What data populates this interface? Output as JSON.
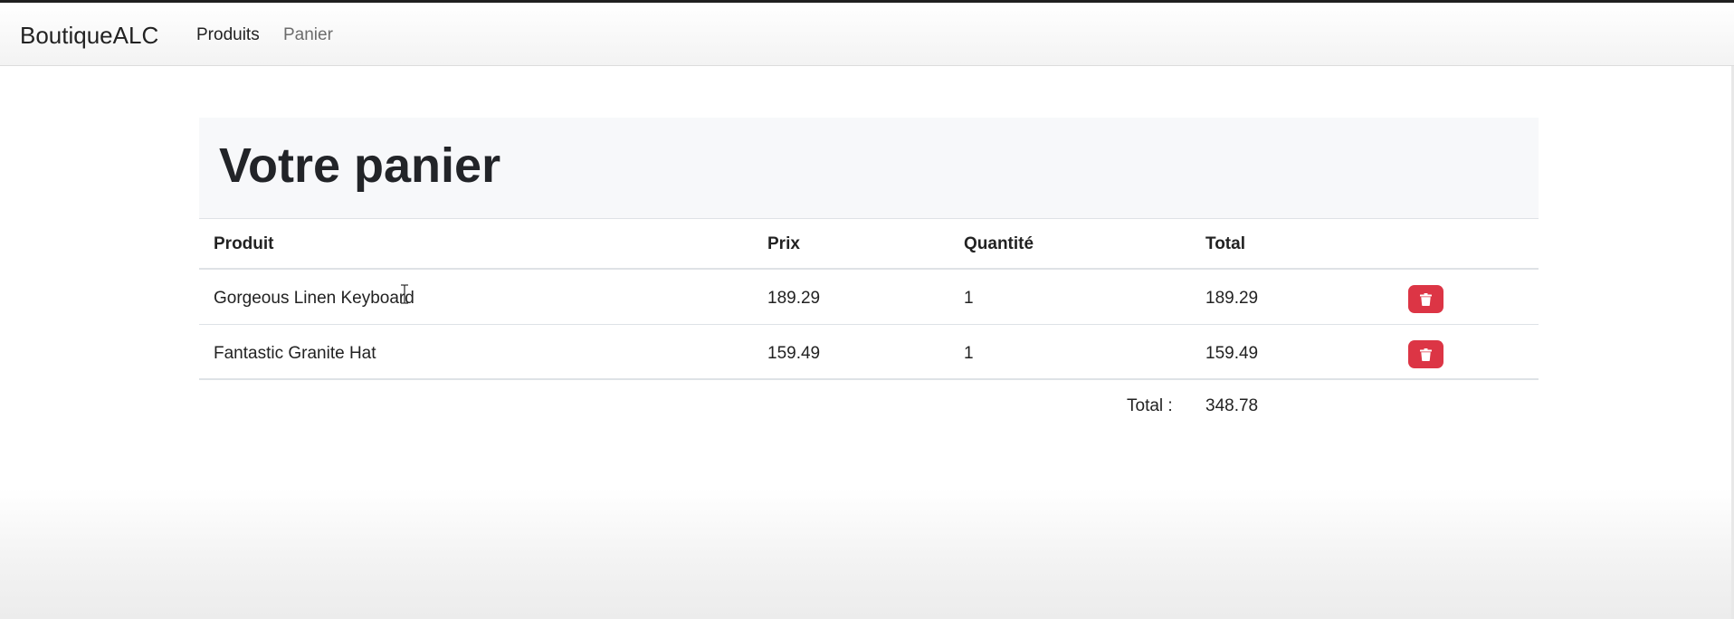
{
  "navbar": {
    "brand": "BoutiqueALC",
    "links": [
      {
        "label": "Produits"
      },
      {
        "label": "Panier"
      }
    ]
  },
  "page": {
    "title": "Votre panier"
  },
  "table": {
    "headers": [
      "Produit",
      "Prix",
      "Quantité",
      "Total"
    ],
    "rows": [
      {
        "produit": "Gorgeous Linen Keyboard",
        "prix": "189.29",
        "quantite": "1",
        "total": "189.29",
        "action_icon": "trash-icon"
      },
      {
        "produit": "Fantastic Granite Hat",
        "prix": "159.49",
        "quantite": "1",
        "total": "159.49",
        "action_icon": "trash-icon"
      }
    ]
  },
  "summary": {
    "total_label": "Total :",
    "total_value": "348.78"
  },
  "colors": {
    "danger": "#dc3545",
    "jumbotron_bg": "#f7f8fa"
  }
}
